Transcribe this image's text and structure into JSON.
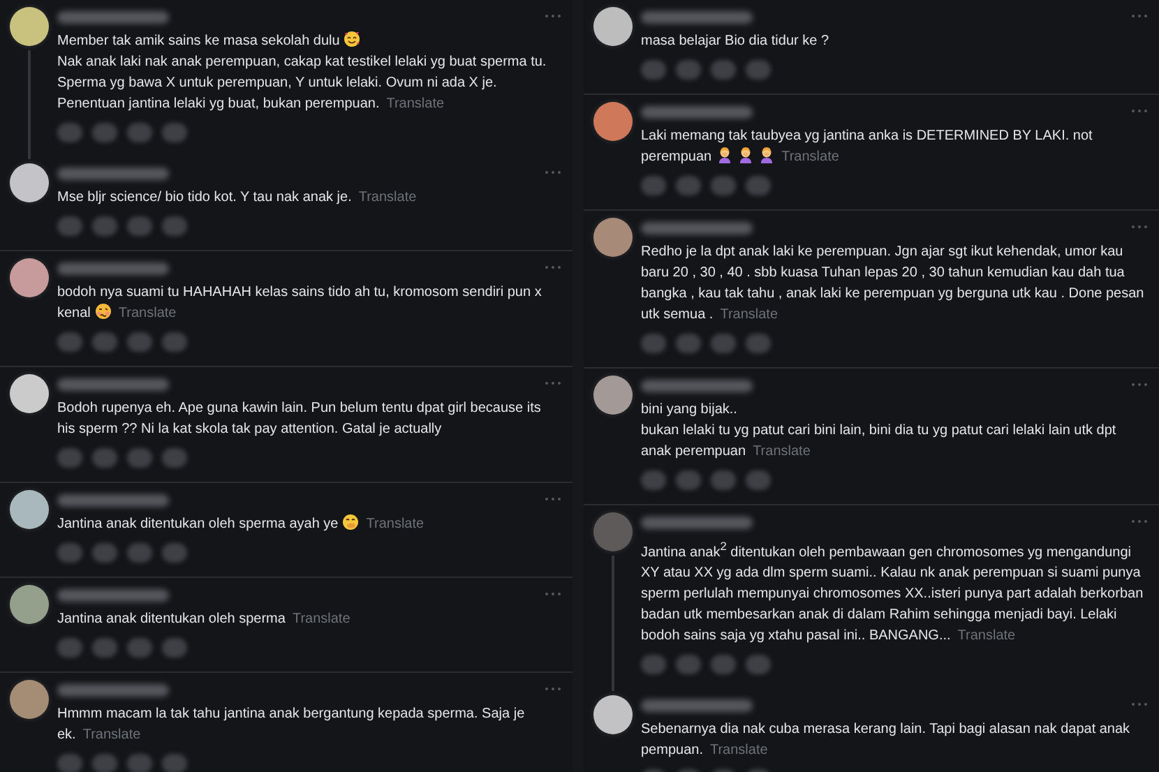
{
  "columns": [
    {
      "comments": [
        {
          "color": "#c8c27e",
          "thread_line": true,
          "paragraphs": [
            {
              "text": "Member tak amik sains ke masa sekolah dulu",
              "icons": [
                {
                  "kind": "hearts"
                }
              ]
            },
            {
              "text": "Nak anak laki nak anak perempuan, cakap kat testikel lelaki yg buat sperma tu. Sperma yg bawa X untuk perempuan, Y untuk lelaki. Ovum ni ada X je. Penentuan jantina lelaki yg buat, bukan perempuan."
            }
          ],
          "translate": "Translate"
        },
        {
          "color": "#c4c4c8",
          "thread_line": false,
          "paragraphs": [
            {
              "text": "Mse bljr science/ bio tido kot. Y tau nak anak je."
            }
          ],
          "translate": "Translate"
        },
        {
          "color": "#c79a9c",
          "thread_line": false,
          "paragraphs": [
            {
              "text": "bodoh nya suami tu HAHAHAH kelas sains tido ah tu, kromosom sendiri pun x kenal",
              "icons": [
                {
                  "kind": "woozy"
                }
              ]
            }
          ],
          "translate": "Translate"
        },
        {
          "color": "#cbcbcb",
          "thread_line": false,
          "paragraphs": [
            {
              "text": "Bodoh rupenya eh. Ape guna kawin lain. Pun belum tentu dpat girl because its his sperm ?? Ni la kat skola tak pay attention. Gatal je actually"
            }
          ]
        },
        {
          "color": "#a9b8bd",
          "thread_line": false,
          "paragraphs": [
            {
              "text": "Jantina anak ditentukan oleh sperma ayah ye",
              "icons": [
                {
                  "kind": "hand-over-mouth"
                }
              ]
            }
          ],
          "translate": "Translate"
        },
        {
          "color": "#94a08c",
          "thread_line": false,
          "paragraphs": [
            {
              "text": "Jantina anak ditentukan oleh sperma"
            }
          ],
          "translate": "Translate"
        },
        {
          "color": "#a58c74",
          "thread_line": false,
          "paragraphs": [
            {
              "text": "Hmmm macam la tak tahu jantina anak bergantung kepada sperma. Saja je ek."
            }
          ],
          "translate": "Translate"
        }
      ]
    },
    {
      "comments": [
        {
          "color": "#bdbdbd",
          "thread_line": false,
          "paragraphs": [
            {
              "text": "masa belajar Bio dia tidur ke ?"
            }
          ]
        },
        {
          "color": "#d0785a",
          "thread_line": false,
          "paragraphs": [
            {
              "text": "Laki memang tak taubyea yg jantina anka is DETERMINED BY LAKI. not perempuan",
              "icons": [
                {
                  "kind": "facepalm"
                },
                {
                  "kind": "facepalm"
                },
                {
                  "kind": "facepalm"
                }
              ]
            }
          ],
          "translate": "Translate"
        },
        {
          "color": "#a88a78",
          "thread_line": false,
          "paragraphs": [
            {
              "text": "Redho je la dpt anak laki ke perempuan. Jgn ajar sgt ikut kehendak, umor kau baru 20 , 30 , 40 . sbb kuasa Tuhan lepas 20 , 30 tahun kemudian kau dah tua bangka , kau tak tahu , anak laki ke perempuan yg berguna utk kau . Done pesan utk semua ."
            }
          ],
          "translate": "Translate"
        },
        {
          "color": "#a39a98",
          "thread_line": false,
          "paragraphs": [
            {
              "text": "bini yang bijak.."
            },
            {
              "text": "bukan lelaki tu yg patut cari bini lain, bini dia tu yg patut cari lelaki lain utk dpt anak perempuan"
            }
          ],
          "translate": "Translate"
        },
        {
          "color": "#5e5a5a",
          "thread_line": true,
          "paragraphs": [
            {
              "text": "Jantina anak$^{2}$ ditentukan oleh pembawaan gen chromosomes yg mengandungi XY atau XX yg ada dlm sperm suami.. Kalau nk anak perempuan si suami punya sperm perlulah mempunyai chromosomes XX..isteri punya part adalah berkorban badan utk membesarkan anak di dalam Rahim sehingga menjadi bayi. Lelaki bodoh sains saja yg xtahu pasal ini.. BANGANG..."
            }
          ],
          "translate": "Translate"
        },
        {
          "color": "#c2c2c4",
          "thread_line": false,
          "paragraphs": [
            {
              "text": "Sebenarnya dia nak cuba merasa kerang lain. Tapi bagi alasan nak dapat anak pempuan."
            }
          ],
          "translate": "Translate"
        }
      ]
    }
  ]
}
